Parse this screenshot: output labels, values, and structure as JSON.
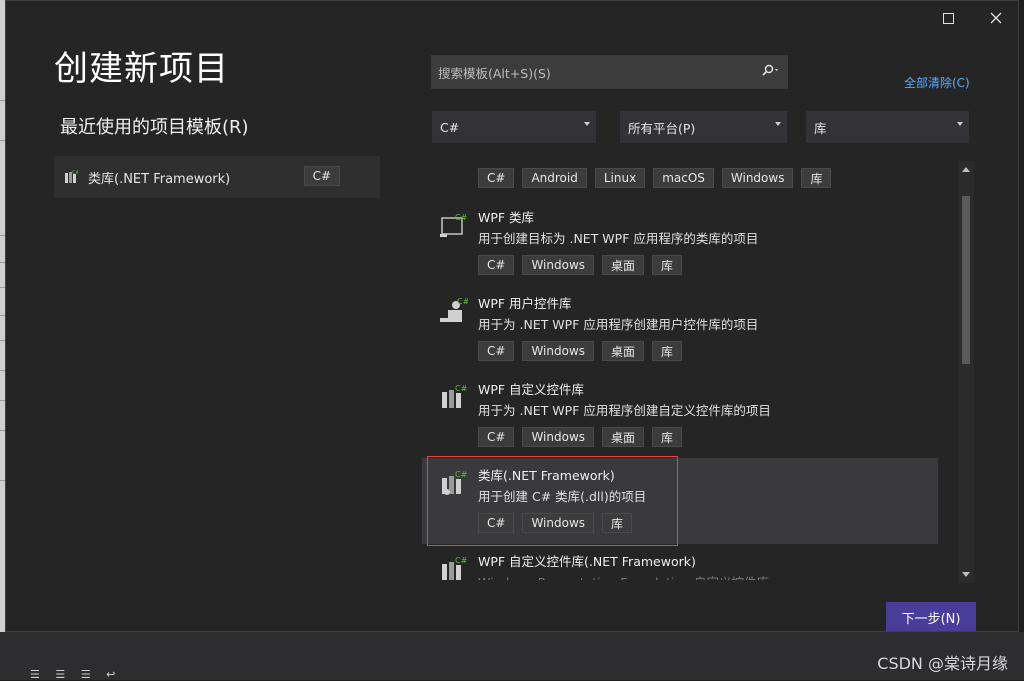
{
  "page_title": "创建新项目",
  "recent": {
    "title": "最近使用的项目模板(R)",
    "item": {
      "label": "类库(.NET Framework)",
      "tag": "C#"
    }
  },
  "search": {
    "placeholder": "搜索模板(Alt+S)(S)"
  },
  "clear_all": "全部清除(C)",
  "filters": {
    "language": "C#",
    "platform": "所有平台(P)",
    "project_type": "库"
  },
  "top_tags": [
    "C#",
    "Android",
    "Linux",
    "macOS",
    "Windows",
    "库"
  ],
  "templates": [
    {
      "name": "WPF 类库",
      "description": "用于创建目标为 .NET WPF 应用程序的类库的项目",
      "tags": [
        "C#",
        "Windows",
        "桌面",
        "库"
      ]
    },
    {
      "name": "WPF 用户控件库",
      "description": "用于为 .NET WPF 应用程序创建用户控件库的项目",
      "tags": [
        "C#",
        "Windows",
        "桌面",
        "库"
      ]
    },
    {
      "name": "WPF 自定义控件库",
      "description": "用于为 .NET WPF 应用程序创建自定义控件库的项目",
      "tags": [
        "C#",
        "Windows",
        "桌面",
        "库"
      ]
    },
    {
      "name": "类库(.NET Framework)",
      "description": "用于创建 C# 类库(.dll)的项目",
      "tags": [
        "C#",
        "Windows",
        "库"
      ]
    },
    {
      "name": "WPF 自定义控件库(.NET Framework)",
      "description": "Windows Presentation Foundation 自定义控件库",
      "tags": []
    }
  ],
  "next_button": "下一步(N)",
  "watermark": "CSDN @棠诗月缘",
  "colors": {
    "accent": "#4a3c99",
    "link": "#5aa9ff",
    "selection_border": "#e0493f",
    "csharp_green": "#5bbf3a"
  }
}
